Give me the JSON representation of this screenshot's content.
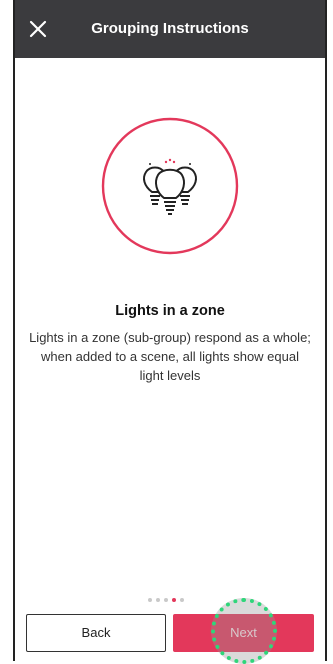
{
  "header": {
    "title": "Grouping Instructions",
    "close_icon": "close-icon"
  },
  "content": {
    "illustration_icon": "light-bulbs-group-icon",
    "title": "Lights in a zone",
    "description": "Lights in a zone (sub-group) respond as a whole; when added to a scene, all lights show equal light levels"
  },
  "pagination": {
    "total_pages": 5,
    "current_page": 4
  },
  "buttons": {
    "back_label": "Back",
    "next_label": "Next"
  },
  "colors": {
    "header_bg": "#3b3b3e",
    "accent": "#e3385b",
    "tap_indicator": "#2fd67a"
  }
}
